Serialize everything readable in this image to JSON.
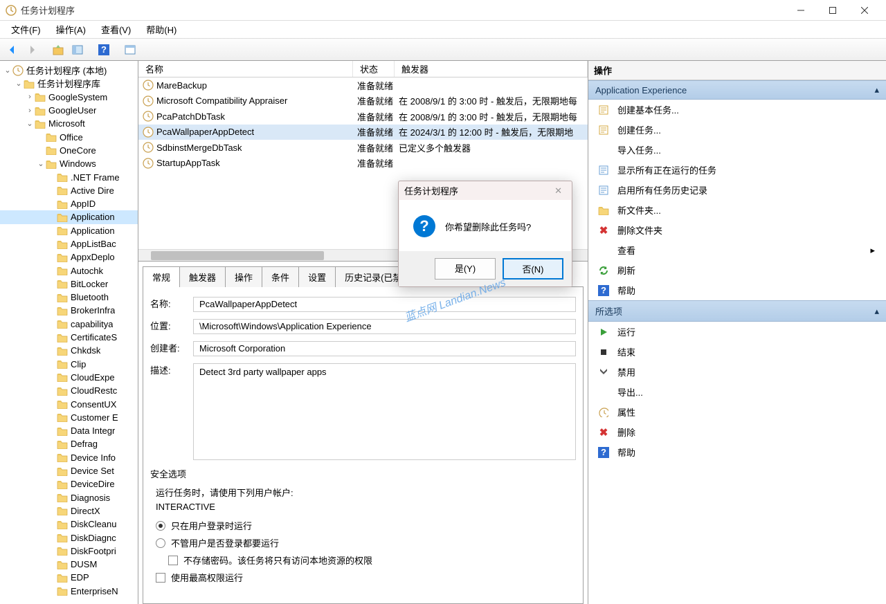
{
  "window": {
    "title": "任务计划程序"
  },
  "menu": {
    "file": "文件(F)",
    "action": "操作(A)",
    "view": "查看(V)",
    "help": "帮助(H)"
  },
  "tree": {
    "root": "任务计划程序 (本地)",
    "library": "任务计划程序库",
    "nodes": [
      "GoogleSystem",
      "GoogleUser",
      "Microsoft",
      "Office",
      "OneCore",
      "Windows",
      ".NET Frame",
      "Active Dire",
      "AppID",
      "Application",
      "Application",
      "AppListBac",
      "AppxDeplo",
      "Autochk",
      "BitLocker",
      "Bluetooth",
      "BrokerInfra",
      "capabilitya",
      "CertificateS",
      "Chkdsk",
      "Clip",
      "CloudExpe",
      "CloudRestc",
      "ConsentUX",
      "Customer E",
      "Data Integr",
      "Defrag",
      "Device Info",
      "Device Set",
      "DeviceDire",
      "Diagnosis",
      "DirectX",
      "DiskCleanu",
      "DiskDiagnc",
      "DiskFootpri",
      "DUSM",
      "EDP",
      "EnterpriseN"
    ]
  },
  "taskList": {
    "headers": {
      "name": "名称",
      "status": "状态",
      "trigger": "触发器"
    },
    "rows": [
      {
        "name": "MareBackup",
        "status": "准备就绪",
        "trigger": ""
      },
      {
        "name": "Microsoft Compatibility Appraiser",
        "status": "准备就绪",
        "trigger": "在 2008/9/1 的 3:00 时 - 触发后，无限期地每"
      },
      {
        "name": "PcaPatchDbTask",
        "status": "准备就绪",
        "trigger": "在 2008/9/1 的 3:00 时 - 触发后，无限期地每"
      },
      {
        "name": "PcaWallpaperAppDetect",
        "status": "准备就绪",
        "trigger": "在 2024/3/1 的 12:00 时 - 触发后，无限期地"
      },
      {
        "name": "SdbinstMergeDbTask",
        "status": "准备就绪",
        "trigger": "已定义多个触发器"
      },
      {
        "name": "StartupAppTask",
        "status": "准备就绪",
        "trigger": ""
      }
    ]
  },
  "tabs": {
    "general": "常规",
    "triggers": "触发器",
    "actions": "操作",
    "conditions": "条件",
    "settings": "设置",
    "history": "历史记录(已禁用)"
  },
  "details": {
    "labels": {
      "name": "名称:",
      "location": "位置:",
      "author": "创建者:",
      "desc": "描述:"
    },
    "name": "PcaWallpaperAppDetect",
    "location": "\\Microsoft\\Windows\\Application Experience",
    "author": "Microsoft Corporation",
    "desc": "Detect 3rd party wallpaper apps",
    "securityHeading": "安全选项",
    "runAsLabel": "运行任务时，请使用下列用户帐户:",
    "runAsValue": "INTERACTIVE",
    "opt1": "只在用户登录时运行",
    "opt2": "不管用户是否登录都要运行",
    "opt2a": "不存储密码。该任务将只有访问本地资源的权限",
    "opt3": "使用最高权限运行"
  },
  "actions": {
    "header": "操作",
    "group1": "Application Experience",
    "items1": [
      "创建基本任务...",
      "创建任务...",
      "导入任务...",
      "显示所有正在运行的任务",
      "启用所有任务历史记录",
      "新文件夹...",
      "删除文件夹",
      "查看",
      "刷新",
      "帮助"
    ],
    "group2": "所选项",
    "items2": [
      "运行",
      "结束",
      "禁用",
      "导出...",
      "属性",
      "删除",
      "帮助"
    ]
  },
  "dialog": {
    "title": "任务计划程序",
    "message": "你希望删除此任务吗?",
    "yes": "是(Y)",
    "no": "否(N)"
  },
  "watermark": "蓝点网 Landian.News"
}
